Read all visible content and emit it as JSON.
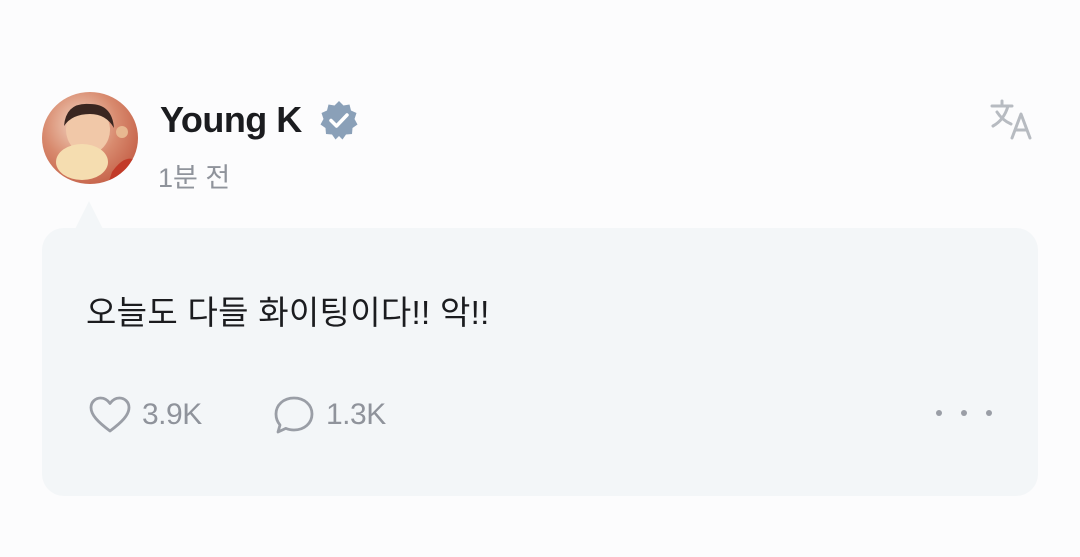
{
  "post": {
    "author": "Young K",
    "verified_icon": "verified-badge-icon",
    "timestamp": "1분 전",
    "text": "오늘도 다들 화이팅이다!! 악!!",
    "likes": "3.9K",
    "comments": "1.3K"
  },
  "icons": {
    "translate": "translate-icon",
    "like": "heart-icon",
    "comment": "speech-bubble-icon",
    "more": "more-dots-icon"
  },
  "colors": {
    "background": "#fcfcfd",
    "card": "#f3f6f8",
    "verified": "#8aa0b8",
    "muted": "#8f939b",
    "text": "#1b1c1f"
  }
}
